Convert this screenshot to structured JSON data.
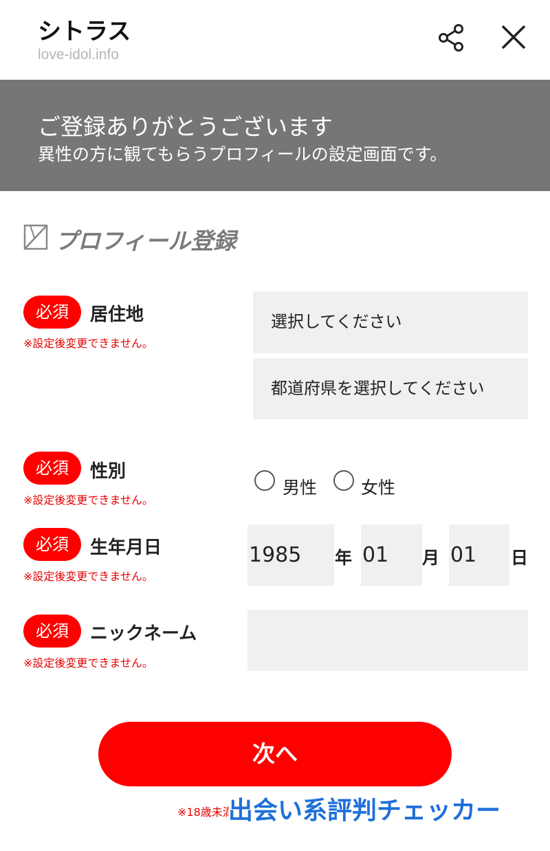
{
  "header": {
    "title": "シトラス",
    "domain": "love-idol.info",
    "share_icon": "share-icon",
    "close_icon": "close-icon"
  },
  "banner": {
    "title": "ご登録ありがとうございます",
    "subtitle": "異性の方に観てもらうプロフィールの設定画面です。"
  },
  "section": {
    "icon": "broken-image-icon",
    "title": "プロフィール登録"
  },
  "form": {
    "required_label": "必須",
    "note": "※設定後変更できません。",
    "residence": {
      "label": "居住地",
      "select1": "選択してください",
      "select2": "都道府県を選択してください"
    },
    "gender": {
      "label": "性別",
      "options": [
        "男性",
        "女性"
      ]
    },
    "birthday": {
      "label": "生年月日",
      "year": "1985",
      "year_unit": "年",
      "month": "01",
      "month_unit": "月",
      "day": "01",
      "day_unit": "日"
    },
    "nickname": {
      "label": "ニックネーム",
      "value": ""
    }
  },
  "next_button": "次へ",
  "footnote": "※18歳未満",
  "watermark": "出会い系評判チェッカー",
  "colors": {
    "accent": "#ff0000",
    "banner": "#767676",
    "field_bg": "#f0f0f0",
    "watermark": "#1e6fd9"
  }
}
